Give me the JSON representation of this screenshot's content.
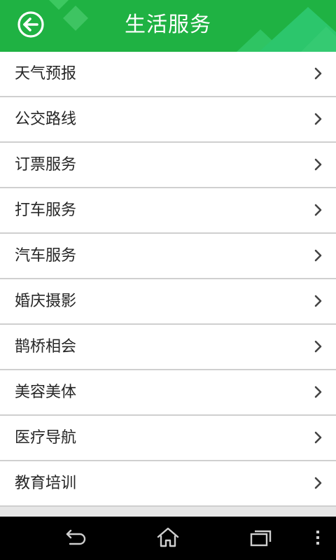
{
  "header": {
    "title": "生活服务",
    "back_icon": "back-arrow-icon",
    "color": "#1fb243"
  },
  "list": {
    "items": [
      {
        "label": "天气预报"
      },
      {
        "label": "公交路线"
      },
      {
        "label": "订票服务"
      },
      {
        "label": "打车服务"
      },
      {
        "label": "汽车服务"
      },
      {
        "label": "婚庆摄影"
      },
      {
        "label": "鹊桥相会"
      },
      {
        "label": "美容美体"
      },
      {
        "label": "医疗导航"
      },
      {
        "label": "教育培训"
      }
    ],
    "chevron_icon": "chevron-right-icon"
  },
  "navbar": {
    "buttons": [
      {
        "icon": "back-icon"
      },
      {
        "icon": "home-icon"
      },
      {
        "icon": "recent-apps-icon"
      },
      {
        "icon": "menu-dots-icon"
      }
    ]
  }
}
